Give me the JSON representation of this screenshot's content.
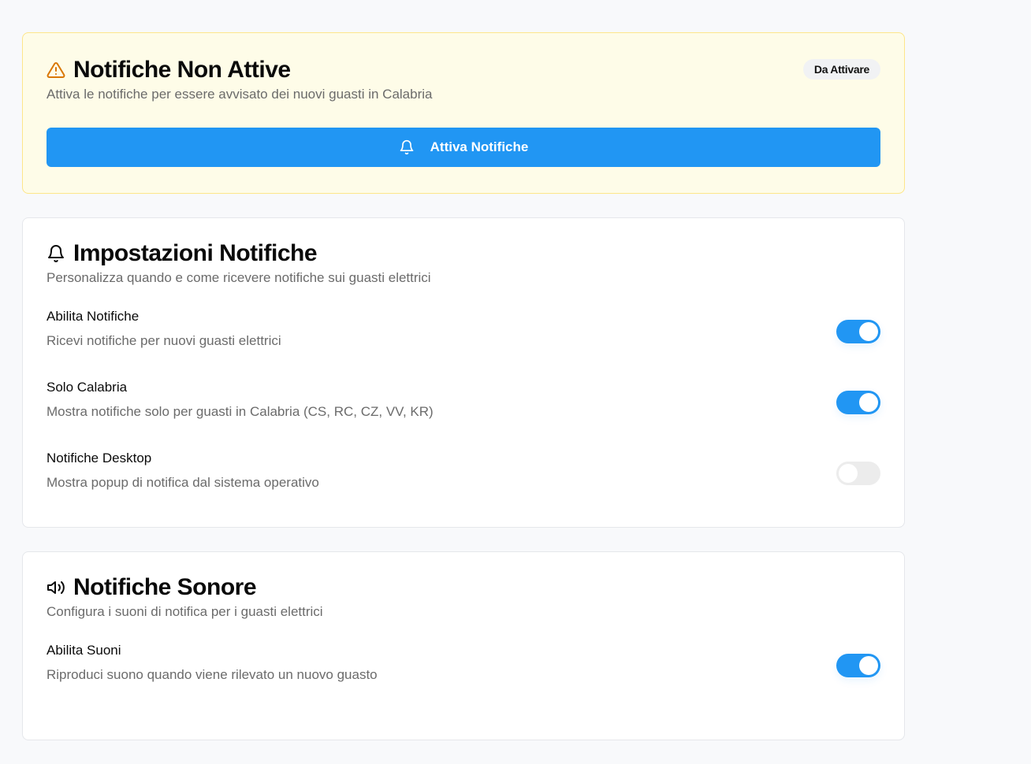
{
  "colors": {
    "accent": "#2196f3",
    "warning": "#d97706",
    "warning_bg": "#fefce8",
    "muted_text": "#6b6b6b"
  },
  "alert": {
    "icon": "warning-triangle-icon",
    "title": "Notifiche Non Attive",
    "badge": "Da Attivare",
    "subtitle": "Attiva le notifiche per essere avvisato dei nuovi guasti in Calabria",
    "button_icon": "bell-icon",
    "button_label": "Attiva Notifiche"
  },
  "settings": {
    "icon": "bell-icon",
    "title": "Impostazioni Notifiche",
    "subtitle": "Personalizza quando e come ricevere notifiche sui guasti elettrici",
    "items": [
      {
        "label": "Abilita Notifiche",
        "description": "Ricevi notifiche per nuovi guasti elettrici",
        "enabled": true
      },
      {
        "label": "Solo Calabria",
        "description": "Mostra notifiche solo per guasti in Calabria (CS, RC, CZ, VV, KR)",
        "enabled": true
      },
      {
        "label": "Notifiche Desktop",
        "description": "Mostra popup di notifica dal sistema operativo",
        "enabled": false
      }
    ]
  },
  "sound": {
    "icon": "speaker-icon",
    "title": "Notifiche Sonore",
    "subtitle": "Configura i suoni di notifica per i guasti elettrici",
    "items": [
      {
        "label": "Abilita Suoni",
        "description": "Riproduci suono quando viene rilevato un nuovo guasto",
        "enabled": true
      }
    ]
  }
}
